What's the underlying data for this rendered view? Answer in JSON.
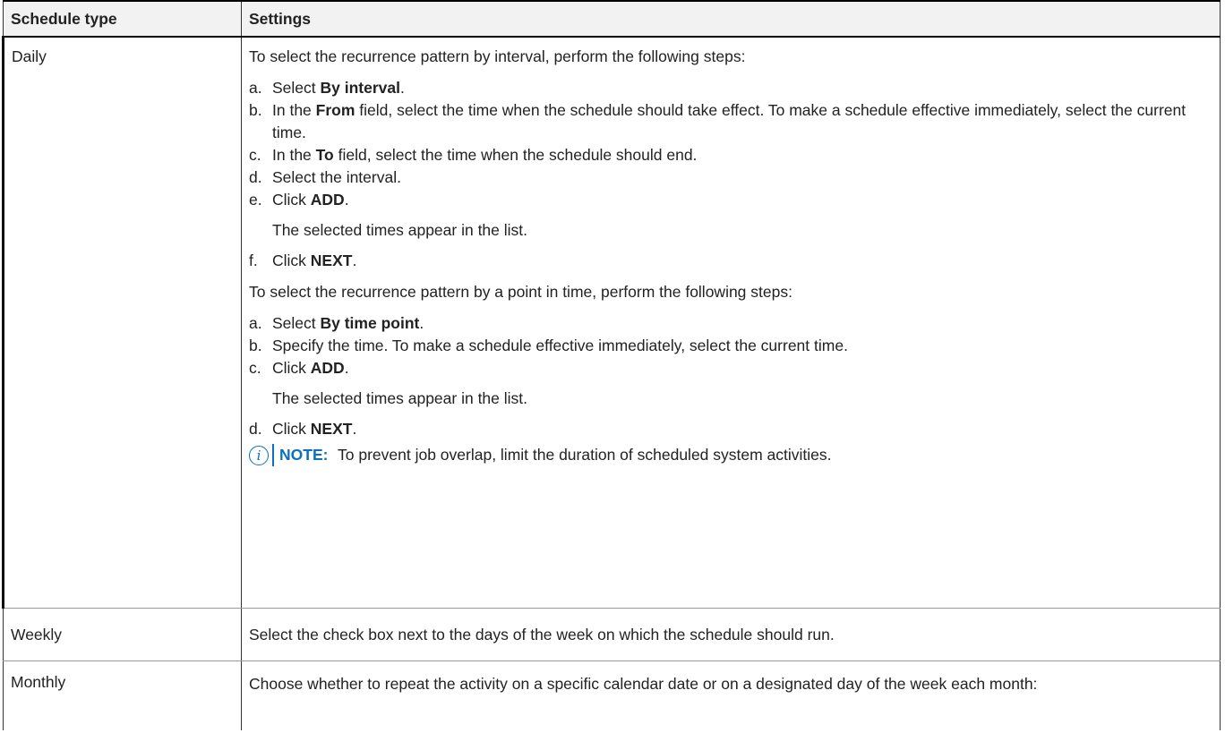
{
  "table": {
    "headers": [
      "Schedule type",
      "Settings"
    ],
    "daily": {
      "type": "Daily",
      "interval_intro": "To select the recurrence pattern by interval, perform the following steps:",
      "interval_steps": [
        {
          "label": "a.",
          "pre": "Select ",
          "bold": "By interval",
          "post": "."
        },
        {
          "label": "b.",
          "pre": "In the ",
          "bold": "From",
          "post": " field, select the time when the schedule should take effect. To make a schedule effective immediately, select the current time."
        },
        {
          "label": "c.",
          "pre": "In the ",
          "bold": "To",
          "post": " field, select the time when the schedule should end."
        },
        {
          "label": "d.",
          "pre": "Select the interval.",
          "bold": "",
          "post": ""
        },
        {
          "label": "e.",
          "pre": "Click ",
          "bold": "ADD",
          "post": "."
        },
        {
          "label": "f.",
          "pre": "Click ",
          "bold": "NEXT",
          "post": "."
        }
      ],
      "interval_result": "The selected times appear in the list.",
      "point_intro": "To select the recurrence pattern by a point in time, perform the following steps:",
      "point_steps": [
        {
          "label": "a.",
          "pre": "Select ",
          "bold": "By time point",
          "post": "."
        },
        {
          "label": "b.",
          "pre": "Specify the time. To make a schedule effective immediately, select the current time.",
          "bold": "",
          "post": ""
        },
        {
          "label": "c.",
          "pre": "Click ",
          "bold": "ADD",
          "post": "."
        },
        {
          "label": "d.",
          "pre": "Click ",
          "bold": "NEXT",
          "post": "."
        }
      ],
      "point_result": "The selected times appear in the list.",
      "note": {
        "icon": "info-icon",
        "label": "NOTE:",
        "text": " To prevent job overlap, limit the duration of scheduled system activities."
      }
    },
    "weekly": {
      "type": "Weekly",
      "text": "Select the check box next to the days of the week on which the schedule should run."
    },
    "monthly": {
      "type": "Monthly",
      "text": "Choose whether to repeat the activity on a specific calendar date or on a designated day of the week each month:"
    }
  },
  "colors": {
    "note_accent": "#0b6fc2",
    "border": "#333333"
  }
}
